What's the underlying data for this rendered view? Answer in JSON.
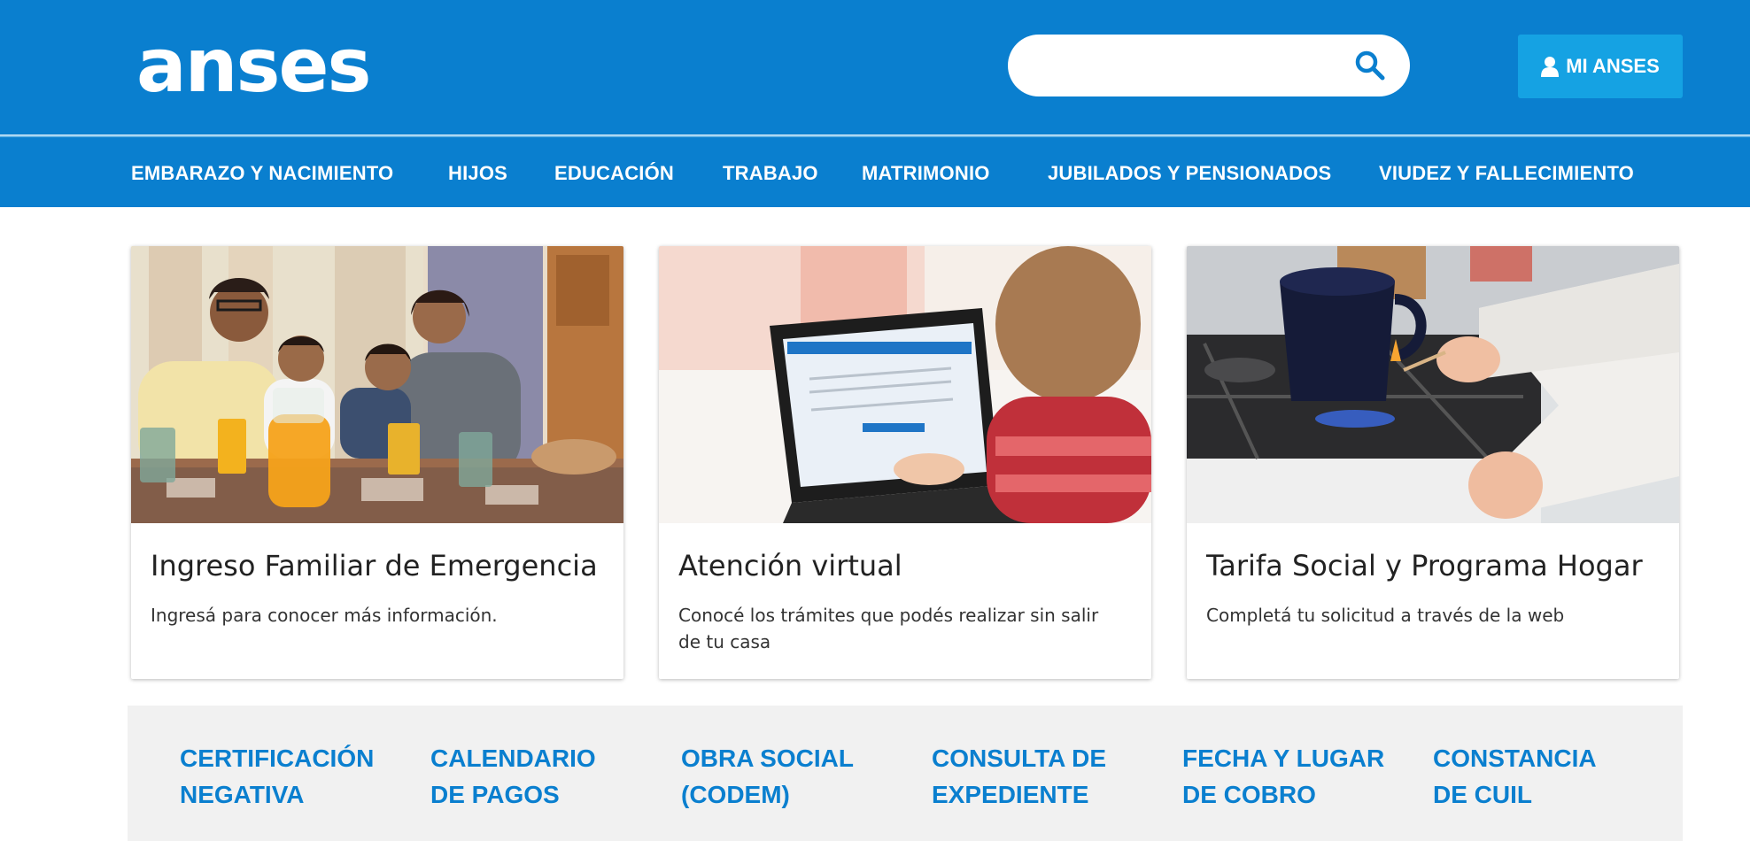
{
  "header": {
    "logo_text": "anses",
    "search": {
      "placeholder": "",
      "icon": "search-icon"
    },
    "account_button": {
      "label": "MI ANSES",
      "icon": "user-icon"
    }
  },
  "nav": {
    "items": [
      {
        "label": "EMBARAZO Y NACIMIENTO"
      },
      {
        "label": "HIJOS"
      },
      {
        "label": "EDUCACIÓN"
      },
      {
        "label": "TRABAJO"
      },
      {
        "label": "MATRIMONIO"
      },
      {
        "label": "JUBILADOS Y PENSIONADOS"
      },
      {
        "label": "VIUDEZ Y FALLECIMIENTO"
      }
    ]
  },
  "cards": [
    {
      "title": "Ingreso Familiar de Emergencia",
      "text": "Ingresá para conocer más información."
    },
    {
      "title": "Atención virtual",
      "text": "Conocé los trámites que podés realizar sin salir de tu casa"
    },
    {
      "title": "Tarifa Social y Programa Hogar",
      "text": "Completá tu solicitud a través de la web"
    }
  ],
  "quick_links": [
    {
      "line1": "CERTIFICACIÓN",
      "line2": "NEGATIVA"
    },
    {
      "line1": "CALENDARIO",
      "line2": "DE PAGOS"
    },
    {
      "line1": "OBRA SOCIAL",
      "line2": "(CODEM)"
    },
    {
      "line1": "CONSULTA DE",
      "line2": "EXPEDIENTE"
    },
    {
      "line1": "FECHA Y LUGAR",
      "line2": "DE COBRO"
    },
    {
      "line1": "CONSTANCIA",
      "line2": "DE CUIL"
    }
  ],
  "colors": {
    "brand_blue": "#0a7fcf",
    "account_button": "#15a2e3",
    "quick_links_bg": "#f1f1f1"
  }
}
